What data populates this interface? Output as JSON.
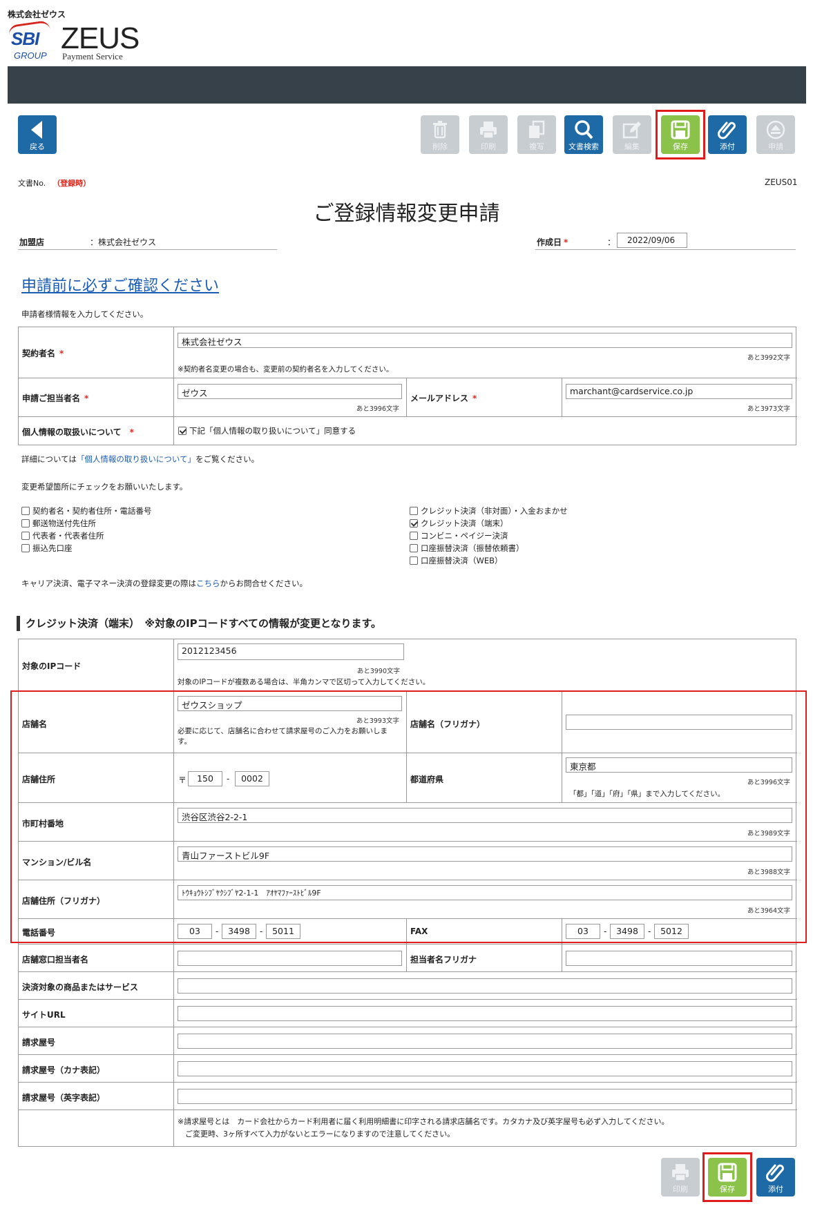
{
  "header": {
    "company_small": "株式会社ゼウス",
    "logo_sbi": "SBI",
    "logo_group": "GROUP",
    "logo_zeus": "ZEUS",
    "logo_payment": "Payment Service"
  },
  "toolbar": {
    "back": "戻る",
    "delete": "削除",
    "print": "印刷",
    "copy": "複写",
    "doc_search": "文書検索",
    "edit": "編集",
    "save": "保存",
    "attach": "添付",
    "apply": "申請"
  },
  "doc": {
    "no_label": "文書No.",
    "no_value": "（登録時）",
    "id": "ZEUS01",
    "title": "ご登録情報変更申請",
    "merchant_label": "加盟店",
    "merchant_value": "：株式会社ゼウス",
    "created_label": "作成日",
    "req_mark": "*",
    "colon": "：",
    "created_value": "2022/09/06"
  },
  "confirm_link": "申請前に必ずご確認ください",
  "applicant_note": "申請者様情報を入力してください。",
  "applicant": {
    "contractor_label": "契約者名",
    "contractor_value": "株式会社ゼウス",
    "contractor_count": "あと3992文字",
    "contractor_note": "※契約者名変更の場合も、変更前の契約者名を入力してください。",
    "person_label": "申請ご担当者名",
    "person_value": "ゼウス",
    "person_count": "あと3996文字",
    "email_label": "メールアドレス",
    "email_value": "marchant@cardservice.co.jp",
    "email_count": "あと3973文字",
    "privacy_label": "個人情報の取扱いについて",
    "privacy_check": "下記「個人情報の取り扱いについて」同意する"
  },
  "details_note": {
    "prefix": "詳細については",
    "link": "「個人情報の取り扱いについて」",
    "suffix": "をご覧ください。"
  },
  "change_note": "変更希望箇所にチェックをお願いいたします。",
  "checks_left": [
    {
      "label": "契約者名・契約者住所・電話番号",
      "checked": false
    },
    {
      "label": "郵送物送付先住所",
      "checked": false
    },
    {
      "label": "代表者・代表者住所",
      "checked": false
    },
    {
      "label": "振込先口座",
      "checked": false
    }
  ],
  "checks_right": [
    {
      "label": "クレジット決済（非対面）・入金おまかせ",
      "checked": false
    },
    {
      "label": "クレジット決済（端末）",
      "checked": true
    },
    {
      "label": "コンビニ・ペイジー決済",
      "checked": false
    },
    {
      "label": "口座振替決済（振替依頼書）",
      "checked": false
    },
    {
      "label": "口座振替決済（WEB）",
      "checked": false
    }
  ],
  "carrier_note": {
    "prefix": "キャリア決済、電子マネー決済の登録変更の際は",
    "link": "こちら",
    "suffix": "からお問合せください。"
  },
  "section_title": "クレジット決済（端末）　※対象のIPコードすべての情報が変更となります。",
  "credit": {
    "ip_label": "対象のIPコード",
    "ip_value": "2012123456",
    "ip_count": "あと3990文字",
    "ip_note": "対象のIPコードが複数ある場合は、半角カンマで区切って入力してください。",
    "shop_label": "店舗名",
    "shop_value": "ゼウスショップ",
    "shop_count": "あと3993文字",
    "shop_note": "必要に応じて、店舗名に合わせて請求屋号のご入力をお願いします。",
    "shop_kana_label": "店舗名（フリガナ）",
    "address_label": "店舗住所",
    "zip_mark": "〒",
    "zip1": "150",
    "zip_sep": "-",
    "zip2": "0002",
    "pref_label": "都道府県",
    "pref_value": "東京都",
    "pref_count": "あと3996文字",
    "pref_note": "「都」「道」「府」「県」まで入力してください。",
    "city_label": "市町村番地",
    "city_value": "渋谷区渋谷2-2-1",
    "city_count": "あと3989文字",
    "building_label": "マンション/ビル名",
    "building_value": "青山ファーストビル9F",
    "building_count": "あと3988文字",
    "address_kana_label": "店舗住所（フリガナ）",
    "address_kana_value": "ﾄｳｷｮｳﾄｼﾌﾞﾔｸｼﾌﾞﾔ2-1-1　ｱｵﾔﾏﾌｧｰｽﾄﾋﾞﾙ9F",
    "address_kana_count": "あと3964文字",
    "tel_label": "電話番号",
    "tel1": "03",
    "tel2": "3498",
    "tel3": "5011",
    "fax_label": "FAX",
    "fax1": "03",
    "fax2": "3498",
    "fax3": "5012",
    "window_label": "店舗窓口担当者名",
    "window_kana_label": "担当者名フリガナ",
    "product_label": "決済対象の商品またはサービス",
    "site_label": "サイトURL",
    "billing_label": "請求屋号",
    "billing_kana_label": "請求屋号（カナ表記）",
    "billing_en_label": "請求屋号（英字表記）",
    "billing_note1": "※請求屋号とは　カード会社からカード利用者に届く利用明細書に印字される請求店舗名です。カタカナ及び英字屋号も必ず入力してください。",
    "billing_note2": "ご変更時、3ヶ所すべて入力がないとエラーになりますので注意してください。"
  },
  "colors": {
    "primary": "#1e6aa6",
    "save": "#8bc34a",
    "disabled": "#c8cdd2",
    "highlight": "#e01b1b",
    "required": "#e0251b"
  }
}
